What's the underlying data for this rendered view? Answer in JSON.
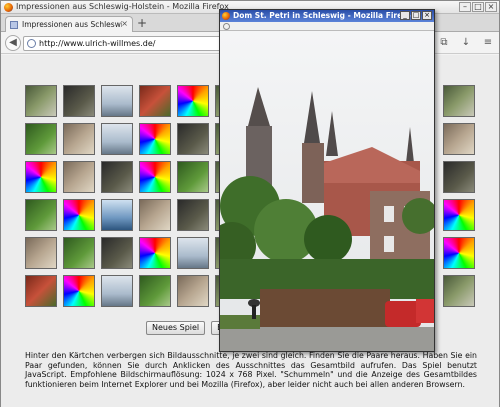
{
  "browser": {
    "window_title": "Impressionen aus Schleswig-Holstein - Mozilla Firefox",
    "tab_label": "Impressionen aus Schleswig-Holst...",
    "new_tab_symbol": "+",
    "url": "http://www.ulrich-willmes.de/"
  },
  "page": {
    "buttons": {
      "new_game": "Neues Spiel",
      "second": "Be"
    },
    "description": "Hinter den Kärtchen verbergen sich Bildausschnitte, je zwei sind gleich. Finden Sie die Paare heraus. Haben Sie ein Paar gefunden, können Sie durch Anklicken des Ausschnittes das Gesamtbild aufrufen. Das Spiel benutzt JavaScript. Empfohlene Bildschirmauflösung: 1024 x 768 Pixel. \"Schummeln\" und die Anzeige des Gesamtbildes funktionieren beim Internet Explorer und bei Mozilla (Firefox), aber leider nicht auch bei allen anderen Browsern."
  },
  "tile_rows": [
    [
      "photo",
      "dark",
      "sky",
      "red",
      "rainbow",
      "photo",
      "",
      "",
      "",
      "",
      "",
      "photo"
    ],
    [
      "green",
      "stone",
      "sky",
      "rainbow",
      "dark",
      "photo",
      "",
      "",
      "",
      "",
      "",
      "stone"
    ],
    [
      "rainbow",
      "stone",
      "dark",
      "rainbow",
      "green",
      "photo",
      "",
      "",
      "",
      "",
      "",
      "dark"
    ],
    [
      "green",
      "rainbow",
      "sea",
      "stone",
      "dark",
      "photo",
      "",
      "",
      "",
      "",
      "",
      "rainbow"
    ],
    [
      "stone",
      "green",
      "dark",
      "rainbow",
      "sky",
      "photo",
      "",
      "",
      "",
      "",
      "",
      "rainbow"
    ],
    [
      "red",
      "rainbow",
      "sky",
      "green",
      "stone",
      "photo",
      "",
      "",
      "",
      "",
      "",
      "photo"
    ]
  ],
  "popup": {
    "title": "Dom St. Petri in Schleswig - Mozilla Firefox",
    "buttons": [
      "_",
      "□",
      "×"
    ]
  }
}
